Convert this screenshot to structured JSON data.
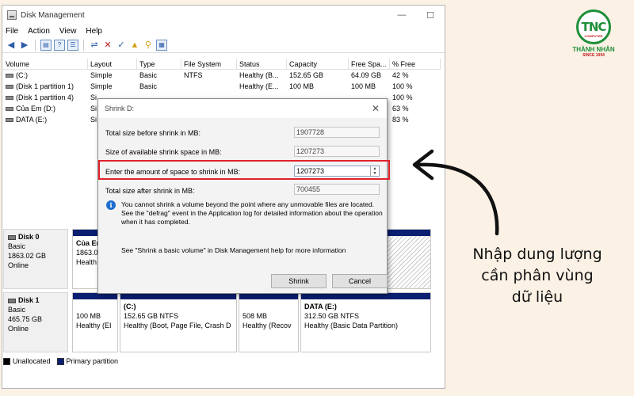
{
  "window": {
    "title": "Disk Management",
    "minimize": "—",
    "maximize": "☐"
  },
  "menu": [
    "File",
    "Action",
    "View",
    "Help"
  ],
  "table": {
    "headers": [
      "Volume",
      "Layout",
      "Type",
      "File System",
      "Status",
      "Capacity",
      "Free Spa...",
      "% Free"
    ],
    "rows": [
      [
        "(C:)",
        "Simple",
        "Basic",
        "NTFS",
        "Healthy (B...",
        "152.65 GB",
        "64.09 GB",
        "42 %"
      ],
      [
        "(Disk 1 partition 1)",
        "Simple",
        "Basic",
        "",
        "Healthy (E...",
        "100 MB",
        "100 MB",
        "100 %"
      ],
      [
        "(Disk 1 partition 4)",
        "Si",
        "",
        "",
        "",
        "",
        "",
        "100 %"
      ],
      [
        "Của Em (D:)",
        "Si",
        "",
        "",
        "",
        "",
        "",
        "63 %"
      ],
      [
        "DATA (E:)",
        "Si",
        "",
        "",
        "",
        "",
        "",
        "83 %"
      ]
    ]
  },
  "disk0": {
    "name": "Disk 0",
    "type": "Basic",
    "size": "1863.02 GB",
    "status": "Online",
    "part1_name": "Của Er",
    "part1_size": "1863.0",
    "part1_status": "Health"
  },
  "disk1": {
    "name": "Disk 1",
    "type": "Basic",
    "size": "465.75 GB",
    "status": "Online",
    "parts": [
      {
        "name": "",
        "size": "100 MB",
        "status": "Healthy (EI"
      },
      {
        "name": "(C:)",
        "size": "152.65 GB NTFS",
        "status": "Healthy (Boot, Page File, Crash D"
      },
      {
        "name": "",
        "size": "508 MB",
        "status": "Healthy (Recov"
      },
      {
        "name": "DATA  (E:)",
        "size": "312.50 GB NTFS",
        "status": "Healthy (Basic Data Partition)"
      }
    ]
  },
  "legend": {
    "unallocated": "Unallocated",
    "primary": "Primary partition",
    "unallocated_color": "#000000",
    "primary_color": "#0b1f72"
  },
  "dialog": {
    "title": "Shrink D:",
    "close": "✕",
    "label_total_before": "Total size before shrink in MB:",
    "value_total_before": "1907728",
    "label_available": "Size of available shrink space in MB:",
    "value_available": "1207273",
    "label_amount": "Enter the amount of space to shrink in MB:",
    "value_amount": "1207273",
    "label_total_after": "Total size after shrink in MB:",
    "value_total_after": "700455",
    "info_icon": "i",
    "info_text": "You cannot shrink a volume beyond the point where any unmovable files are located. See the \"defrag\" event in the Application log for detailed information about the operation when it has completed.",
    "help_text": "See \"Shrink a basic volume\" in Disk Management help for more information",
    "shrink_button": "Shrink",
    "cancel_button": "Cancel"
  },
  "caption": {
    "line1": "Nhập dung lượng",
    "line2": "cần phân vùng",
    "line3": "dữ liệu"
  },
  "logo": {
    "mark": "TNC",
    "sub": "COMPUTER",
    "brand": "THÀNH NHÂN",
    "since": "SINCE 1994"
  },
  "colors": {
    "highlight": "#e0222a",
    "primary_partition": "#0b1f72",
    "logo_green": "#1e8f3a"
  }
}
